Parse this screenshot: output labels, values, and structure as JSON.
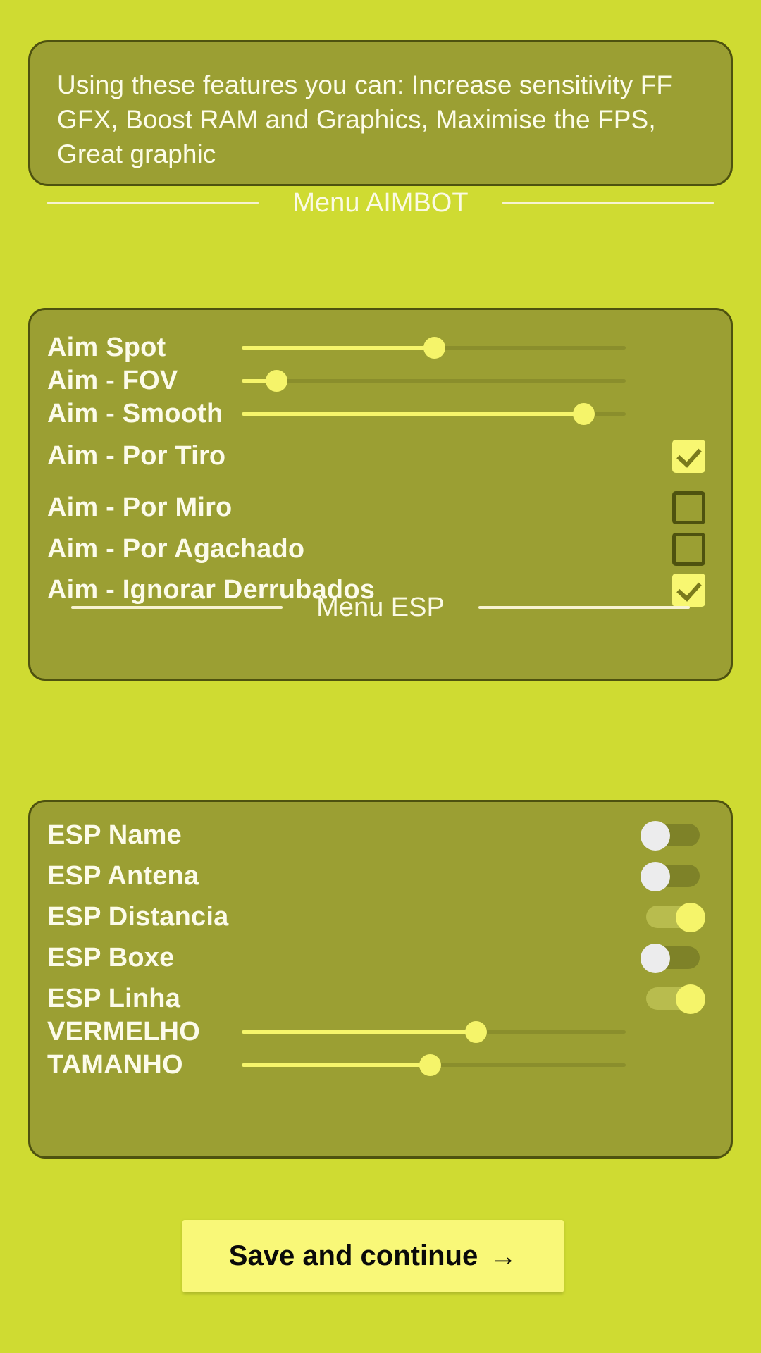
{
  "intro": {
    "text": "Using these features you can: Increase sensitivity FF GFX, Boost RAM and Graphics, Maximise the FPS, Great graphic"
  },
  "sections": [
    {
      "id": "aimbot",
      "title": "Menu AIMBOT"
    },
    {
      "id": "esp",
      "title": "Menu ESP"
    }
  ],
  "aimbot": {
    "rows": [
      {
        "label": "Aim Spot",
        "control": "slider",
        "value": 50
      },
      {
        "label": "Aim - FOV",
        "control": "slider",
        "value": 9
      },
      {
        "label": "Aim - Smooth",
        "control": "slider",
        "value": 89
      },
      {
        "label": "Aim - Por Tiro",
        "control": "checkbox",
        "checked": true
      },
      {
        "label": "Aim - Por Miro",
        "control": "checkbox",
        "checked": false
      },
      {
        "label": "Aim - Por Agachado",
        "control": "checkbox",
        "checked": false
      },
      {
        "label": "Aim - Ignorar Derrubados",
        "control": "checkbox",
        "checked": true
      }
    ]
  },
  "esp": {
    "rows": [
      {
        "label": "ESP Name",
        "control": "toggle",
        "on": false
      },
      {
        "label": "ESP Antena",
        "control": "toggle",
        "on": false
      },
      {
        "label": "ESP Distancia",
        "control": "toggle",
        "on": true
      },
      {
        "label": "ESP Boxe",
        "control": "toggle",
        "on": false
      },
      {
        "label": "ESP Linha",
        "control": "toggle",
        "on": true
      },
      {
        "label": "VERMELHO",
        "control": "slider",
        "value": 61
      },
      {
        "label": "TAMANHO",
        "control": "slider",
        "value": 49
      }
    ]
  },
  "footer": {
    "save_label": "Save and continue",
    "save_arrow": "→"
  },
  "colors": {
    "background": "#cfdb32",
    "panel": "#9b9f33",
    "panel_border": "#4e520f",
    "label_text": "#fcfbe9",
    "accent_yellow": "#f5f46a",
    "button_bg": "#f9f878",
    "button_text": "#0a0a0a",
    "divider": "#f7f3d2",
    "toggle_off_knob": "#ececed"
  }
}
